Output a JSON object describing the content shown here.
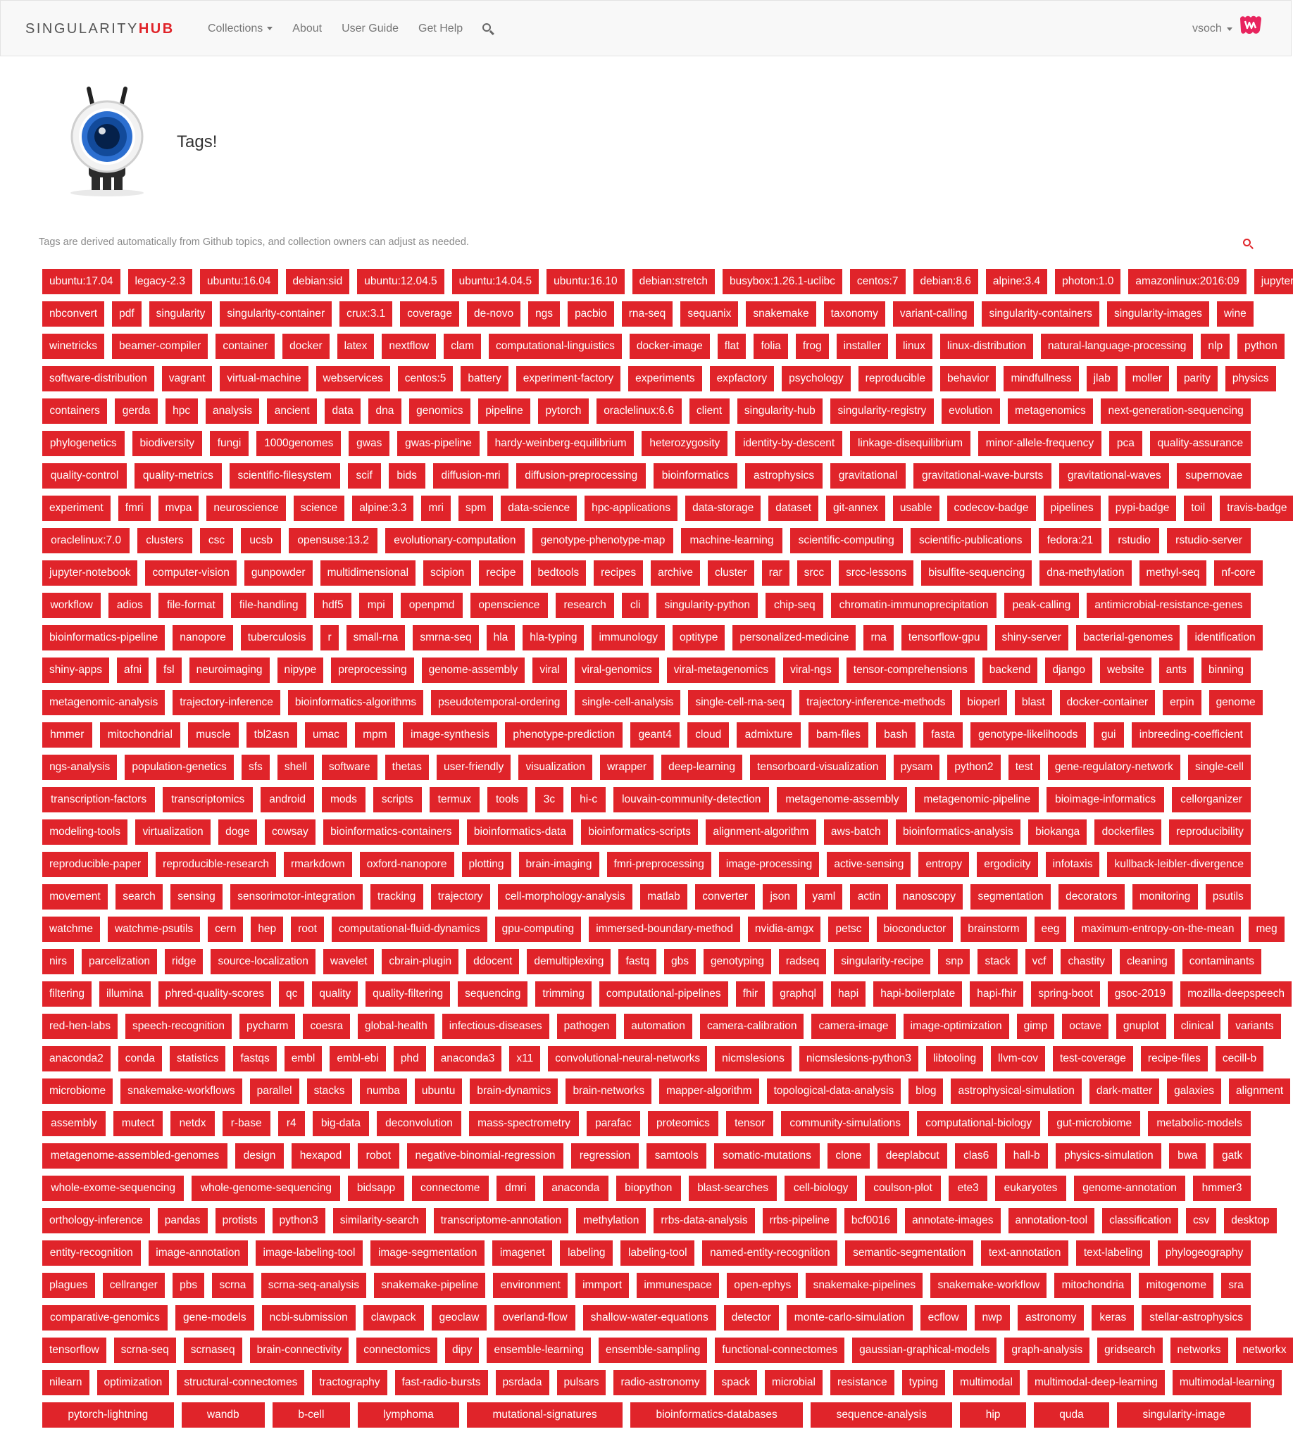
{
  "navbar": {
    "brand_a": "SINGULARITY",
    "brand_b": "HUB",
    "items": [
      "Collections",
      "About",
      "User Guide",
      "Get Help"
    ],
    "username": "vsoch"
  },
  "page": {
    "title": "Tags!",
    "description": "Tags are derived automatically from Github topics, and collection owners can adjust as needed."
  },
  "colors": {
    "tag_bg": "#e0242a",
    "brand_red": "#e0242a"
  },
  "tag_rows": [
    [
      "ubuntu:17.04",
      "legacy-2.3",
      "ubuntu:16.04",
      "debian:sid",
      "ubuntu:12.04.5",
      "ubuntu:14.04.5",
      "ubuntu:16.10",
      "debian:stretch",
      "busybox:1.26.1-uclibc",
      "centos:7",
      "debian:8.6",
      "alpine:3.4",
      "photon:1.0",
      "amazonlinux:2016:09",
      "jupyter"
    ],
    [
      "nbconvert",
      "pdf",
      "singularity",
      "singularity-container",
      "crux:3.1",
      "coverage",
      "de-novo",
      "ngs",
      "pacbio",
      "rna-seq",
      "sequanix",
      "snakemake",
      "taxonomy",
      "variant-calling",
      "singularity-containers",
      "singularity-images",
      "wine"
    ],
    [
      "winetricks",
      "beamer-compiler",
      "container",
      "docker",
      "latex",
      "nextflow",
      "clam",
      "computational-linguistics",
      "docker-image",
      "flat",
      "folia",
      "frog",
      "installer",
      "linux",
      "linux-distribution",
      "natural-language-processing",
      "nlp",
      "python"
    ],
    [
      "software-distribution",
      "vagrant",
      "virtual-machine",
      "webservices",
      "centos:5",
      "battery",
      "experiment-factory",
      "experiments",
      "expfactory",
      "psychology",
      "reproducible",
      "behavior",
      "mindfullness",
      "jlab",
      "moller",
      "parity",
      "physics"
    ],
    [
      "containers",
      "gerda",
      "hpc",
      "analysis",
      "ancient",
      "data",
      "dna",
      "genomics",
      "pipeline",
      "pytorch",
      "oraclelinux:6.6",
      "client",
      "singularity-hub",
      "singularity-registry",
      "evolution",
      "metagenomics",
      "next-generation-sequencing"
    ],
    [
      "phylogenetics",
      "biodiversity",
      "fungi",
      "1000genomes",
      "gwas",
      "gwas-pipeline",
      "hardy-weinberg-equilibrium",
      "heterozygosity",
      "identity-by-descent",
      "linkage-disequilibrium",
      "minor-allele-frequency",
      "pca",
      "quality-assurance"
    ],
    [
      "quality-control",
      "quality-metrics",
      "scientific-filesystem",
      "scif",
      "bids",
      "diffusion-mri",
      "diffusion-preprocessing",
      "bioinformatics",
      "astrophysics",
      "gravitational",
      "gravitational-wave-bursts",
      "gravitational-waves",
      "supernovae"
    ],
    [
      "experiment",
      "fmri",
      "mvpa",
      "neuroscience",
      "science",
      "alpine:3.3",
      "mri",
      "spm",
      "data-science",
      "hpc-applications",
      "data-storage",
      "dataset",
      "git-annex",
      "usable",
      "codecov-badge",
      "pipelines",
      "pypi-badge",
      "toil",
      "travis-badge"
    ],
    [
      "oraclelinux:7.0",
      "clusters",
      "csc",
      "ucsb",
      "opensuse:13.2",
      "evolutionary-computation",
      "genotype-phenotype-map",
      "machine-learning",
      "scientific-computing",
      "scientific-publications",
      "fedora:21",
      "rstudio",
      "rstudio-server"
    ],
    [
      "jupyter-notebook",
      "computer-vision",
      "gunpowder",
      "multidimensional",
      "scipion",
      "recipe",
      "bedtools",
      "recipes",
      "archive",
      "cluster",
      "rar",
      "srcc",
      "srcc-lessons",
      "bisulfite-sequencing",
      "dna-methylation",
      "methyl-seq",
      "nf-core"
    ],
    [
      "workflow",
      "adios",
      "file-format",
      "file-handling",
      "hdf5",
      "mpi",
      "openpmd",
      "openscience",
      "research",
      "cli",
      "singularity-python",
      "chip-seq",
      "chromatin-immunoprecipitation",
      "peak-calling",
      "antimicrobial-resistance-genes"
    ],
    [
      "bioinformatics-pipeline",
      "nanopore",
      "tuberculosis",
      "r",
      "small-rna",
      "smrna-seq",
      "hla",
      "hla-typing",
      "immunology",
      "optitype",
      "personalized-medicine",
      "rna",
      "tensorflow-gpu",
      "shiny-server",
      "bacterial-genomes",
      "identification"
    ],
    [
      "shiny-apps",
      "afni",
      "fsl",
      "neuroimaging",
      "nipype",
      "preprocessing",
      "genome-assembly",
      "viral",
      "viral-genomics",
      "viral-metagenomics",
      "viral-ngs",
      "tensor-comprehensions",
      "backend",
      "django",
      "website",
      "ants",
      "binning"
    ],
    [
      "metagenomic-analysis",
      "trajectory-inference",
      "bioinformatics-algorithms",
      "pseudotemporal-ordering",
      "single-cell-analysis",
      "single-cell-rna-seq",
      "trajectory-inference-methods",
      "bioperl",
      "blast",
      "docker-container",
      "erpin",
      "genome"
    ],
    [
      "hmmer",
      "mitochondrial",
      "muscle",
      "tbl2asn",
      "umac",
      "mpm",
      "image-synthesis",
      "phenotype-prediction",
      "geant4",
      "cloud",
      "admixture",
      "bam-files",
      "bash",
      "fasta",
      "genotype-likelihoods",
      "gui",
      "inbreeding-coefficient"
    ],
    [
      "ngs-analysis",
      "population-genetics",
      "sfs",
      "shell",
      "software",
      "thetas",
      "user-friendly",
      "visualization",
      "wrapper",
      "deep-learning",
      "tensorboard-visualization",
      "pysam",
      "python2",
      "test",
      "gene-regulatory-network",
      "single-cell"
    ],
    [
      "transcription-factors",
      "transcriptomics",
      "android",
      "mods",
      "scripts",
      "termux",
      "tools",
      "3c",
      "hi-c",
      "louvain-community-detection",
      "metagenome-assembly",
      "metagenomic-pipeline",
      "bioimage-informatics",
      "cellorganizer"
    ],
    [
      "modeling-tools",
      "virtualization",
      "doge",
      "cowsay",
      "bioinformatics-containers",
      "bioinformatics-data",
      "bioinformatics-scripts",
      "alignment-algorithm",
      "aws-batch",
      "bioinformatics-analysis",
      "biokanga",
      "dockerfiles",
      "reproducibility"
    ],
    [
      "reproducible-paper",
      "reproducible-research",
      "rmarkdown",
      "oxford-nanopore",
      "plotting",
      "brain-imaging",
      "fmri-preprocessing",
      "image-processing",
      "active-sensing",
      "entropy",
      "ergodicity",
      "infotaxis",
      "kullback-leibler-divergence"
    ],
    [
      "movement",
      "search",
      "sensing",
      "sensorimotor-integration",
      "tracking",
      "trajectory",
      "cell-morphology-analysis",
      "matlab",
      "converter",
      "json",
      "yaml",
      "actin",
      "nanoscopy",
      "segmentation",
      "decorators",
      "monitoring",
      "psutils"
    ],
    [
      "watchme",
      "watchme-psutils",
      "cern",
      "hep",
      "root",
      "computational-fluid-dynamics",
      "gpu-computing",
      "immersed-boundary-method",
      "nvidia-amgx",
      "petsc",
      "bioconductor",
      "brainstorm",
      "eeg",
      "maximum-entropy-on-the-mean",
      "meg"
    ],
    [
      "nirs",
      "parcelization",
      "ridge",
      "source-localization",
      "wavelet",
      "cbrain-plugin",
      "ddocent",
      "demultiplexing",
      "fastq",
      "gbs",
      "genotyping",
      "radseq",
      "singularity-recipe",
      "snp",
      "stack",
      "vcf",
      "chastity",
      "cleaning",
      "contaminants"
    ],
    [
      "filtering",
      "illumina",
      "phred-quality-scores",
      "qc",
      "quality",
      "quality-filtering",
      "sequencing",
      "trimming",
      "computational-pipelines",
      "fhir",
      "graphql",
      "hapi",
      "hapi-boilerplate",
      "hapi-fhir",
      "spring-boot",
      "gsoc-2019",
      "mozilla-deepspeech"
    ],
    [
      "red-hen-labs",
      "speech-recognition",
      "pycharm",
      "coesra",
      "global-health",
      "infectious-diseases",
      "pathogen",
      "automation",
      "camera-calibration",
      "camera-image",
      "image-optimization",
      "gimp",
      "octave",
      "gnuplot",
      "clinical",
      "variants"
    ],
    [
      "anaconda2",
      "conda",
      "statistics",
      "fastqs",
      "embl",
      "embl-ebi",
      "phd",
      "anaconda3",
      "x11",
      "convolutional-neural-networks",
      "nicmslesions",
      "nicmslesions-python3",
      "libtooling",
      "llvm-cov",
      "test-coverage",
      "recipe-files",
      "cecill-b"
    ],
    [
      "microbiome",
      "snakemake-workflows",
      "parallel",
      "stacks",
      "numba",
      "ubuntu",
      "brain-dynamics",
      "brain-networks",
      "mapper-algorithm",
      "topological-data-analysis",
      "blog",
      "astrophysical-simulation",
      "dark-matter",
      "galaxies",
      "alignment"
    ],
    [
      "assembly",
      "mutect",
      "netdx",
      "r-base",
      "r4",
      "big-data",
      "deconvolution",
      "mass-spectrometry",
      "parafac",
      "proteomics",
      "tensor",
      "community-simulations",
      "computational-biology",
      "gut-microbiome",
      "metabolic-models"
    ],
    [
      "metagenome-assembled-genomes",
      "design",
      "hexapod",
      "robot",
      "negative-binomial-regression",
      "regression",
      "samtools",
      "somatic-mutations",
      "clone",
      "deeplabcut",
      "clas6",
      "hall-b",
      "physics-simulation",
      "bwa",
      "gatk"
    ],
    [
      "whole-exome-sequencing",
      "whole-genome-sequencing",
      "bidsapp",
      "connectome",
      "dmri",
      "anaconda",
      "biopython",
      "blast-searches",
      "cell-biology",
      "coulson-plot",
      "ete3",
      "eukaryotes",
      "genome-annotation",
      "hmmer3"
    ],
    [
      "orthology-inference",
      "pandas",
      "protists",
      "python3",
      "similarity-search",
      "transcriptome-annotation",
      "methylation",
      "rrbs-data-analysis",
      "rrbs-pipeline",
      "bcf0016",
      "annotate-images",
      "annotation-tool",
      "classification",
      "csv",
      "desktop"
    ],
    [
      "entity-recognition",
      "image-annotation",
      "image-labeling-tool",
      "image-segmentation",
      "imagenet",
      "labeling",
      "labeling-tool",
      "named-entity-recognition",
      "semantic-segmentation",
      "text-annotation",
      "text-labeling",
      "phylogeography"
    ],
    [
      "plagues",
      "cellranger",
      "pbs",
      "scrna",
      "scrna-seq-analysis",
      "snakemake-pipeline",
      "environment",
      "immport",
      "immunespace",
      "open-ephys",
      "snakemake-pipelines",
      "snakemake-workflow",
      "mitochondria",
      "mitogenome",
      "sra"
    ],
    [
      "comparative-genomics",
      "gene-models",
      "ncbi-submission",
      "clawpack",
      "geoclaw",
      "overland-flow",
      "shallow-water-equations",
      "detector",
      "monte-carlo-simulation",
      "ecflow",
      "nwp",
      "astronomy",
      "keras",
      "stellar-astrophysics"
    ],
    [
      "tensorflow",
      "scrna-seq",
      "scrnaseq",
      "brain-connectivity",
      "connectomics",
      "dipy",
      "ensemble-learning",
      "ensemble-sampling",
      "functional-connectomes",
      "gaussian-graphical-models",
      "graph-analysis",
      "gridsearch",
      "networks",
      "networkx"
    ],
    [
      "nilearn",
      "optimization",
      "structural-connectomes",
      "tractography",
      "fast-radio-bursts",
      "psrdada",
      "pulsars",
      "radio-astronomy",
      "spack",
      "microbial",
      "resistance",
      "typing",
      "multimodal",
      "multimodal-deep-learning",
      "multimodal-learning"
    ],
    [
      "pytorch-lightning",
      "wandb",
      "b-cell",
      "lymphoma",
      "mutational-signatures",
      "bioinformatics-databases",
      "sequence-analysis",
      "hip",
      "quda",
      "singularity-image"
    ]
  ]
}
